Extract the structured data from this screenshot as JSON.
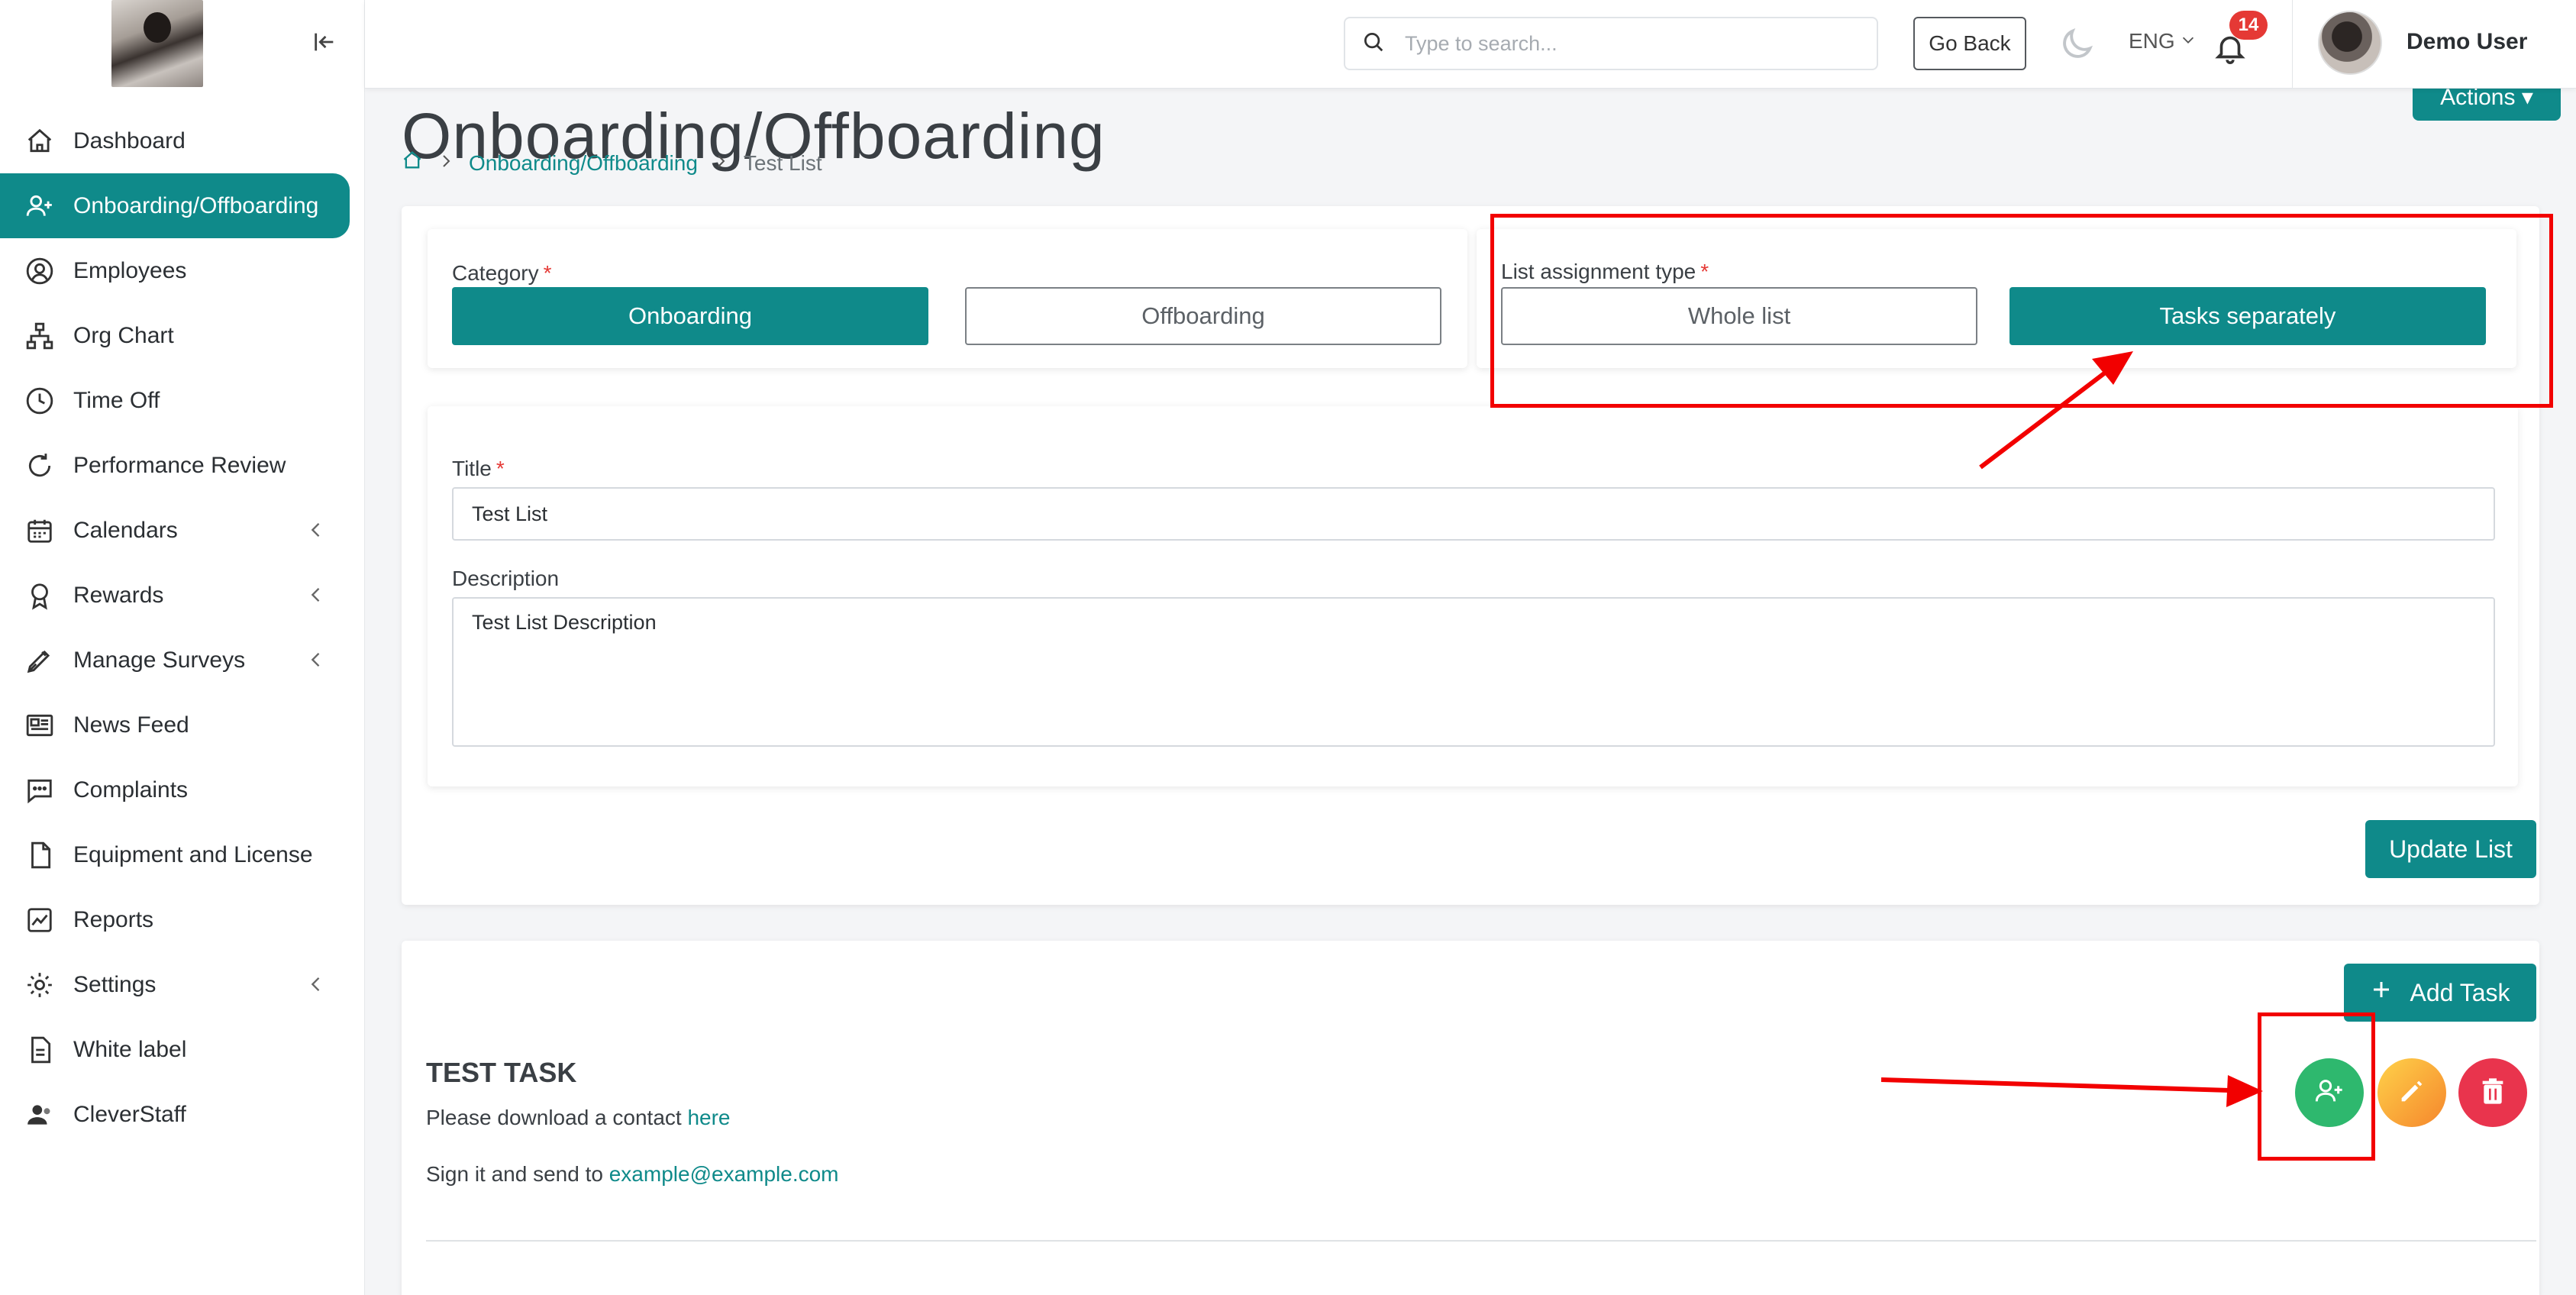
{
  "user": {
    "name": "Demo User",
    "notifications": "14"
  },
  "header": {
    "search_placeholder": "Type to search...",
    "go_back": "Go Back",
    "language": "ENG"
  },
  "sidebar": {
    "items": [
      {
        "label": "Dashboard",
        "icon": "home-icon"
      },
      {
        "label": "Onboarding/Offboarding",
        "icon": "user-plus-icon",
        "active": true
      },
      {
        "label": "Employees",
        "icon": "user-circle-icon"
      },
      {
        "label": "Org Chart",
        "icon": "org-chart-icon"
      },
      {
        "label": "Time Off",
        "icon": "clock-icon"
      },
      {
        "label": "Performance Review",
        "icon": "refresh-icon"
      },
      {
        "label": "Calendars",
        "icon": "calendar-icon",
        "expandable": true
      },
      {
        "label": "Rewards",
        "icon": "award-icon",
        "expandable": true
      },
      {
        "label": "Manage Surveys",
        "icon": "pen-icon",
        "expandable": true
      },
      {
        "label": "News Feed",
        "icon": "newspaper-icon"
      },
      {
        "label": "Complaints",
        "icon": "chat-icon"
      },
      {
        "label": "Equipment and License",
        "icon": "file-icon"
      },
      {
        "label": "Reports",
        "icon": "chart-icon"
      },
      {
        "label": "Settings",
        "icon": "gear-icon",
        "expandable": true
      },
      {
        "label": "White label",
        "icon": "document-icon"
      },
      {
        "label": "CleverStaff",
        "icon": "users-icon"
      }
    ]
  },
  "page": {
    "title": "Onboarding/Offboarding",
    "actions": "Actions ▾",
    "breadcrumb": {
      "section": "Onboarding/Offboarding",
      "current": "Test List"
    }
  },
  "form": {
    "category_label": "Category",
    "category_options": [
      "Onboarding",
      "Offboarding"
    ],
    "category_selected": "Onboarding",
    "assignment_label": "List assignment type",
    "assignment_options": [
      "Whole list",
      "Tasks separately"
    ],
    "assignment_selected": "Tasks separately",
    "title_label": "Title",
    "title_value": "Test List",
    "description_label": "Description",
    "description_value": "Test List Description",
    "update_button": "Update List"
  },
  "tasks": {
    "add_button": "Add Task",
    "items": [
      {
        "title": "TEST TASK",
        "line1_text": "Please download a contact ",
        "line1_link": "here",
        "line2_text": "Sign it and send to ",
        "line2_link": "example@example.com"
      }
    ]
  },
  "colors": {
    "accent": "#0f8a8a",
    "annotation": "#f20000",
    "danger": "#e9344d",
    "success": "#2eb86e"
  }
}
